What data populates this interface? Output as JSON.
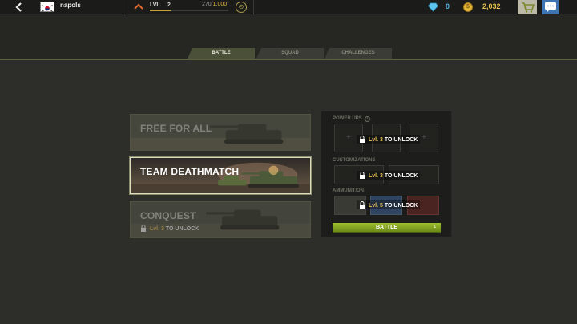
{
  "topbar": {
    "player_name": "napols",
    "level_label": "LVL.",
    "level": "2",
    "xp_current": "270/",
    "xp_max": "1,000",
    "xp_progress": 0.27,
    "gems": "0",
    "coins": "2,032"
  },
  "tabs": [
    {
      "label": "BATTLE",
      "active": true
    },
    {
      "label": "SQUAD",
      "active": false
    },
    {
      "label": "CHALLENGES",
      "active": false
    }
  ],
  "modes": [
    {
      "title": "FREE FOR ALL",
      "state": "available"
    },
    {
      "title": "TEAM DEATHMATCH",
      "state": "selected"
    },
    {
      "title": "CONQUEST",
      "state": "locked",
      "lock_lvl": "Lvl. 3",
      "lock_suffix": "TO UNLOCK"
    }
  ],
  "loadout": {
    "powerups_label": "POWER UPS",
    "customizations_label": "CUSTOMIZATIONS",
    "ammunition_label": "AMMUNITION",
    "powerups_lock_lvl": "Lvl. 3",
    "customizations_lock_lvl": "Lvl. 3",
    "ammunition_lock_lvl": "Lvl. 5",
    "lock_suffix": "TO UNLOCK",
    "slot_plus": "+",
    "battle_label": "BATTLE",
    "battle_cost": "1"
  },
  "colors": {
    "accent_green": "#8fb02a",
    "gold": "#e7c04e",
    "gem_blue": "#4fb8e8",
    "chat_blue": "#3e74b3"
  },
  "icons": [
    "back-arrow-icon",
    "korea-flag-icon",
    "rank-chevron-icon",
    "badge-icon",
    "gem-icon",
    "coin-icon",
    "cart-icon",
    "chat-icon",
    "lock-icon",
    "info-icon"
  ]
}
